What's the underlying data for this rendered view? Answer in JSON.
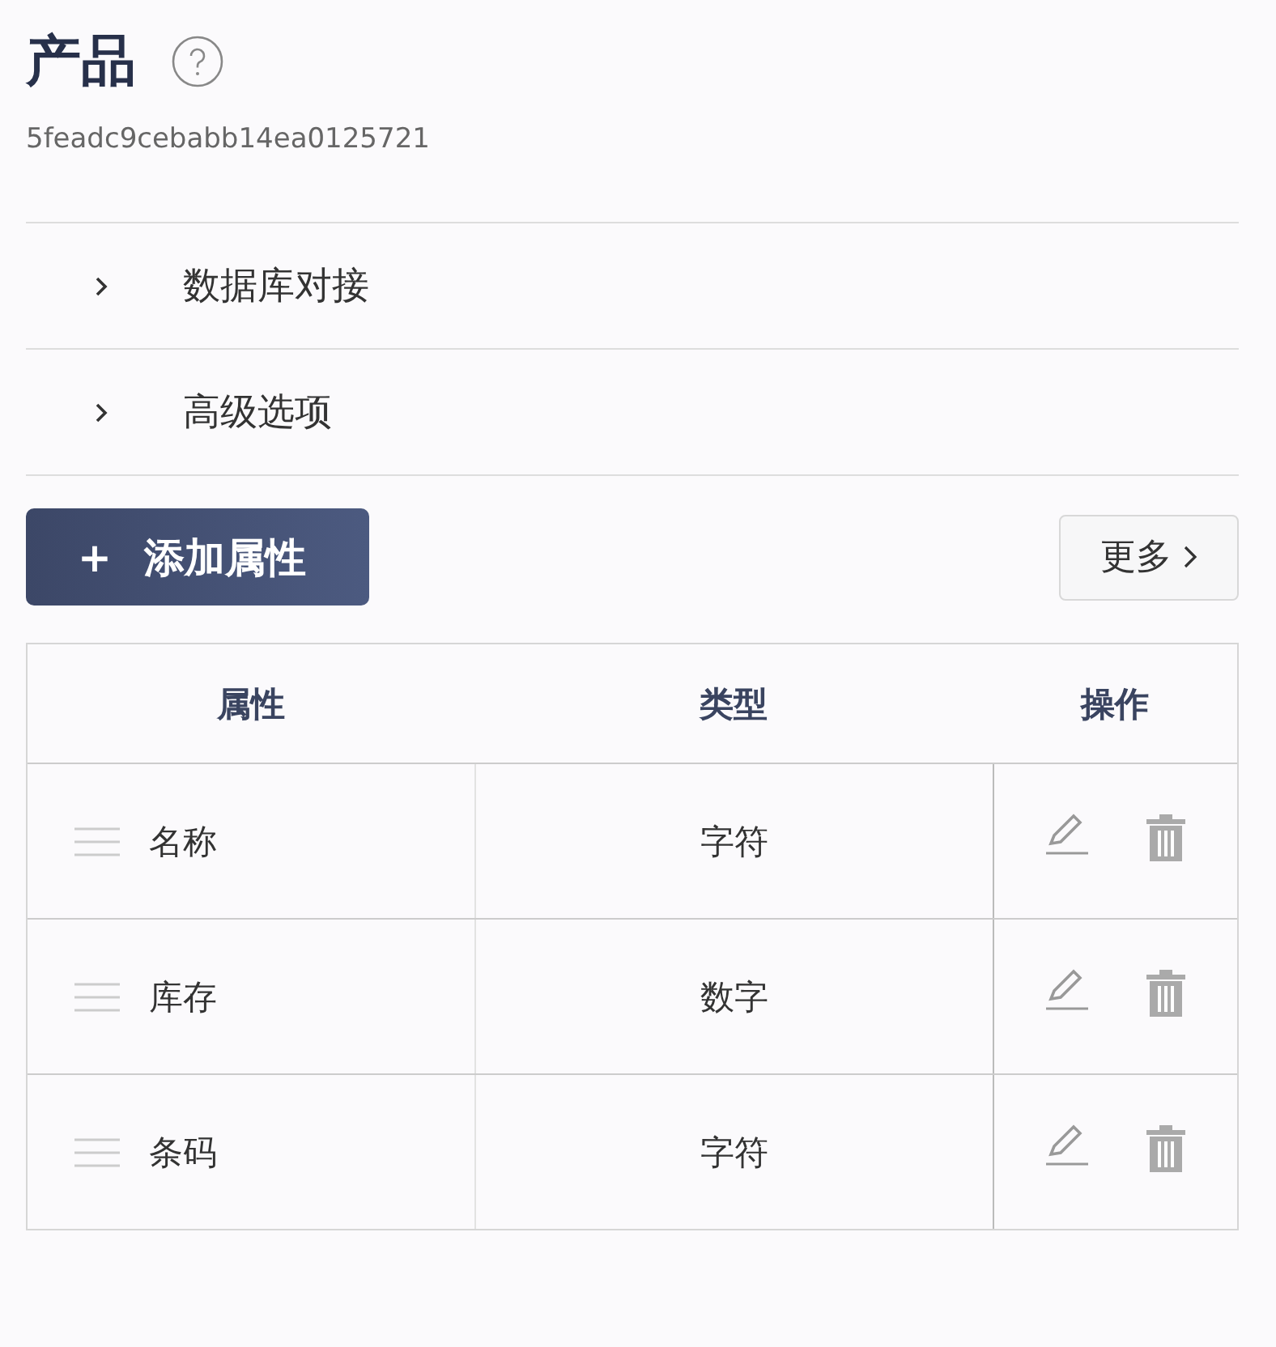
{
  "title": "产品",
  "id_text": "5feadc9cebabb14ea0125721",
  "sections": [
    {
      "label": "数据库对接",
      "expanded": false
    },
    {
      "label": "高级选项",
      "expanded": false
    }
  ],
  "add_button": {
    "icon": "+",
    "label": "添加属性"
  },
  "more_button": {
    "label": "更多"
  },
  "table": {
    "columns": [
      "属性",
      "类型",
      "操作"
    ],
    "rows": [
      {
        "name": "名称",
        "type": "字符"
      },
      {
        "name": "库存",
        "type": "数字"
      },
      {
        "name": "条码",
        "type": "字符"
      }
    ]
  }
}
